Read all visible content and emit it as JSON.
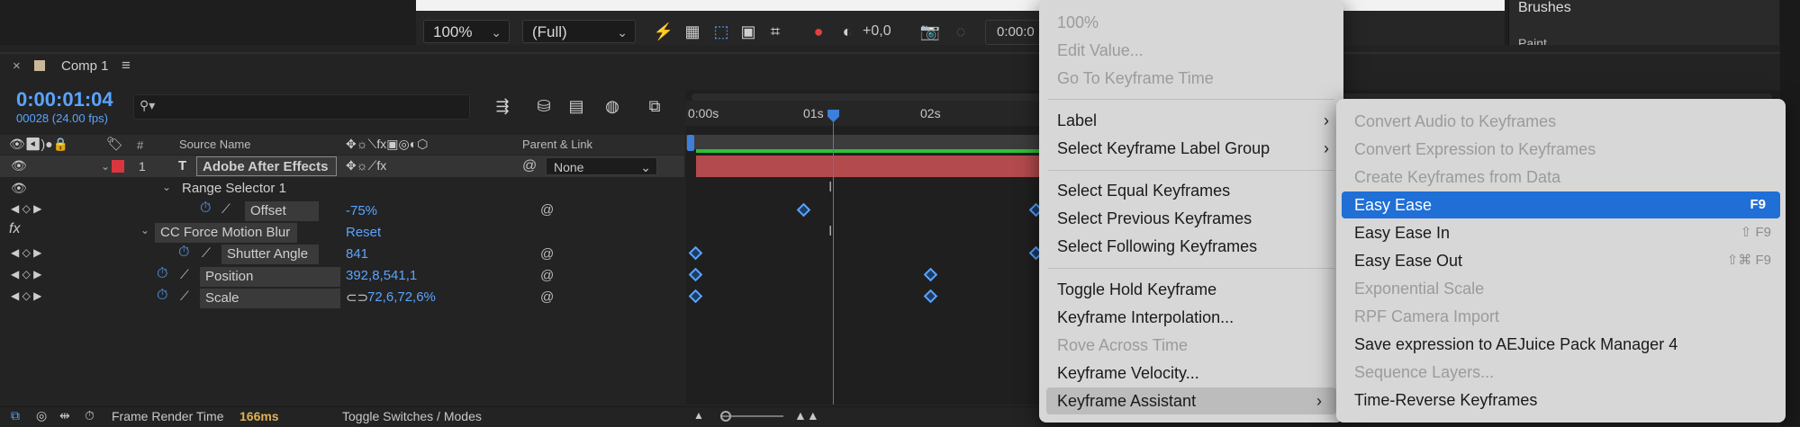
{
  "viewer": {
    "zoom": "100%",
    "resolution": "(Full)",
    "exposure": "+0,0",
    "timecode_partial": "0:00:0"
  },
  "panels": {
    "brushes": "Brushes",
    "paint": "Paint"
  },
  "comp": {
    "tab_label": "Comp 1",
    "timecode": "0:00:01:04",
    "frame_info": "00028 (24.00 fps)",
    "ruler": [
      "0:00s",
      "01s",
      "02s"
    ]
  },
  "columns": {
    "num": "#",
    "source_name": "Source Name",
    "parent_link": "Parent & Link"
  },
  "layers": {
    "layer1_num": "1",
    "layer1_name": "Adobe After Effects",
    "layer1_parent": "None",
    "range_selector": "Range Selector 1",
    "offset_label": "Offset",
    "offset_value": "-75%",
    "cc_blur": "CC Force Motion Blur",
    "reset": "Reset",
    "shutter_label": "Shutter Angle",
    "shutter_value": "841",
    "position_label": "Position",
    "position_value": "392,8,541,1",
    "scale_label": "Scale",
    "scale_value": "72,6,72,6%"
  },
  "bottom_bar": {
    "render_label": "Frame Render Time",
    "render_value": "166ms",
    "toggle": "Toggle Switches / Modes"
  },
  "context_menu": {
    "items": [
      {
        "label": "100%",
        "disabled": true
      },
      {
        "label": "Edit Value...",
        "disabled": true
      },
      {
        "label": "Go To Keyframe Time",
        "disabled": true
      },
      {
        "label": "Label",
        "disabled": false
      },
      {
        "label": "Select Keyframe Label Group",
        "disabled": false
      },
      {
        "label": "Select Equal Keyframes",
        "disabled": false
      },
      {
        "label": "Select Previous Keyframes",
        "disabled": false
      },
      {
        "label": "Select Following Keyframes",
        "disabled": false
      },
      {
        "label": "Toggle Hold Keyframe",
        "disabled": false
      },
      {
        "label": "Keyframe Interpolation...",
        "disabled": false
      },
      {
        "label": "Rove Across Time",
        "disabled": true
      },
      {
        "label": "Keyframe Velocity...",
        "disabled": false
      },
      {
        "label": "Keyframe Assistant",
        "disabled": false
      }
    ]
  },
  "submenu": {
    "items": [
      {
        "label": "Convert Audio to Keyframes",
        "disabled": true
      },
      {
        "label": "Convert Expression to Keyframes",
        "disabled": true
      },
      {
        "label": "Create Keyframes from Data",
        "disabled": true
      },
      {
        "label": "Easy Ease",
        "shortcut": "F9",
        "highlighted": true
      },
      {
        "label": "Easy Ease In",
        "shortcut": "⇧ F9"
      },
      {
        "label": "Easy Ease Out",
        "shortcut": "⇧⌘ F9"
      },
      {
        "label": "Exponential Scale",
        "disabled": true
      },
      {
        "label": "RPF Camera Import",
        "disabled": true
      },
      {
        "label": "Save expression to AEJuice Pack Manager 4",
        "disabled": false
      },
      {
        "label": "Sequence Layers...",
        "disabled": true
      },
      {
        "label": "Time-Reverse Keyframes",
        "disabled": false
      }
    ]
  },
  "colors": {
    "accent": "#5aa4ff",
    "highlight": "#1f6fd6",
    "layer_bar": "#b24a4e",
    "label_red": "#d9363e"
  }
}
